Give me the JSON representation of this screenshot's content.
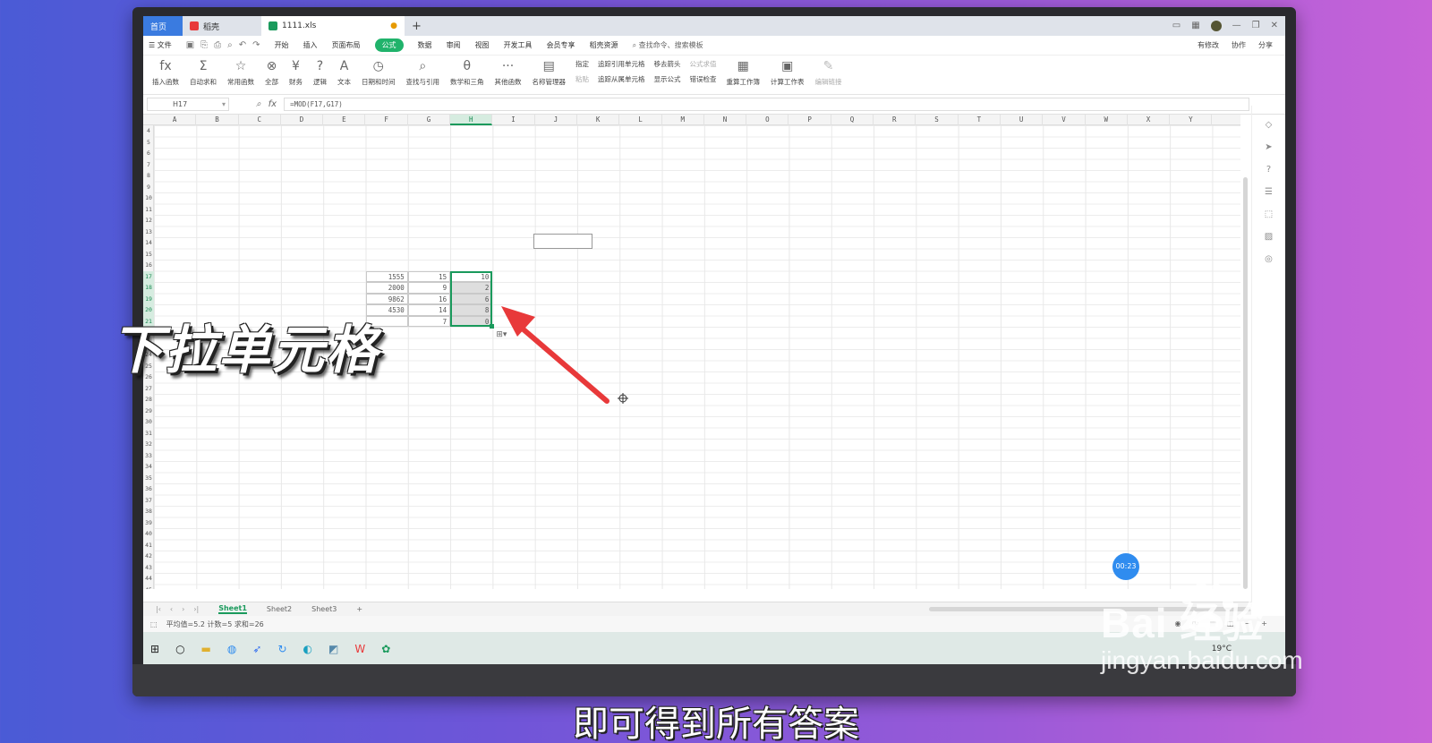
{
  "titlebar": {
    "home_tab": "首页",
    "daoke_tab": "稻壳",
    "file_tab": "1111.xls",
    "new_tab": "+"
  },
  "menubar": {
    "file": "☰ 文件",
    "items": [
      "开始",
      "插入",
      "页面布局",
      "公式",
      "数据",
      "审阅",
      "视图",
      "开发工具",
      "会员专享",
      "稻壳资源"
    ],
    "active": "公式",
    "search": "查找命令、搜索模板",
    "right": [
      "有修改",
      "协作",
      "分享"
    ]
  },
  "ribbon": {
    "buttons": [
      {
        "glyph": "fx",
        "label": "插入函数"
      },
      {
        "glyph": "Σ",
        "label": "自动求和"
      },
      {
        "glyph": "☆",
        "label": "常用函数"
      },
      {
        "glyph": "⊗",
        "label": "全部"
      },
      {
        "glyph": "¥",
        "label": "财务"
      },
      {
        "glyph": "?",
        "label": "逻辑"
      },
      {
        "glyph": "A",
        "label": "文本"
      },
      {
        "glyph": "◷",
        "label": "日期和时间"
      },
      {
        "glyph": "⌕",
        "label": "查找与引用"
      },
      {
        "glyph": "θ",
        "label": "数学和三角"
      },
      {
        "glyph": "···",
        "label": "其他函数"
      },
      {
        "glyph": "▤",
        "label": "名称管理器"
      }
    ],
    "stack1": [
      "指定",
      "粘贴"
    ],
    "stack2": [
      "追踪引用单元格",
      "追踪从属单元格"
    ],
    "stack3": [
      "移去箭头",
      "显示公式"
    ],
    "stack4": [
      "公式求值",
      "错误检查"
    ],
    "buttons2": [
      {
        "glyph": "▦",
        "label": "重算工作簿"
      },
      {
        "glyph": "▣",
        "label": "计算工作表"
      },
      {
        "glyph": "✎",
        "label": "编辑链接"
      }
    ]
  },
  "formulabar": {
    "namebox": "H17",
    "formula": "=MOD(F17,G17)"
  },
  "grid": {
    "columns": [
      "A",
      "B",
      "C",
      "D",
      "E",
      "F",
      "G",
      "H",
      "I",
      "J",
      "K",
      "L",
      "M",
      "N",
      "O",
      "P",
      "Q",
      "R",
      "S",
      "T",
      "U",
      "V",
      "W",
      "X",
      "Y"
    ],
    "selected_column": "H",
    "rows": [
      "4",
      "5",
      "6",
      "7",
      "8",
      "9",
      "10",
      "11",
      "12",
      "13",
      "14",
      "15",
      "16",
      "17",
      "18",
      "19",
      "20",
      "21",
      "22",
      "23",
      "24",
      "25",
      "26",
      "27",
      "28",
      "29",
      "30",
      "31",
      "32",
      "33",
      "34",
      "35",
      "36",
      "37",
      "38",
      "39",
      "40",
      "41",
      "42",
      "43",
      "44",
      "45"
    ],
    "selected_rows": [
      "17",
      "18",
      "19",
      "20",
      "21"
    ],
    "data": [
      {
        "row": "17",
        "F": "1555",
        "G": "15",
        "H": "10"
      },
      {
        "row": "18",
        "F": "2000",
        "G": "9",
        "H": "2"
      },
      {
        "row": "19",
        "F": "9862",
        "G": "16",
        "H": "6"
      },
      {
        "row": "20",
        "F": "4530",
        "G": "14",
        "H": "8"
      },
      {
        "row": "21",
        "F": "",
        "G": "7",
        "H": "0"
      }
    ]
  },
  "sheets": {
    "tabs": [
      "Sheet1",
      "Sheet2",
      "Sheet3"
    ],
    "active": "Sheet1",
    "add": "+"
  },
  "status": {
    "summary": "平均值=5.2  计数=5  求和=26"
  },
  "taskbar": {
    "weather": "19°C"
  },
  "timer": "00:23",
  "overlay": {
    "caption": "下拉单元格",
    "subtitle": "即可得到所有答案",
    "watermark_brand": "Bai  经验",
    "watermark_url": "jingyan.baidu.com"
  },
  "colors": {
    "accent_green": "#1a9a5c",
    "arrow_red": "#e8393a",
    "timer_blue": "#2f8cef"
  }
}
